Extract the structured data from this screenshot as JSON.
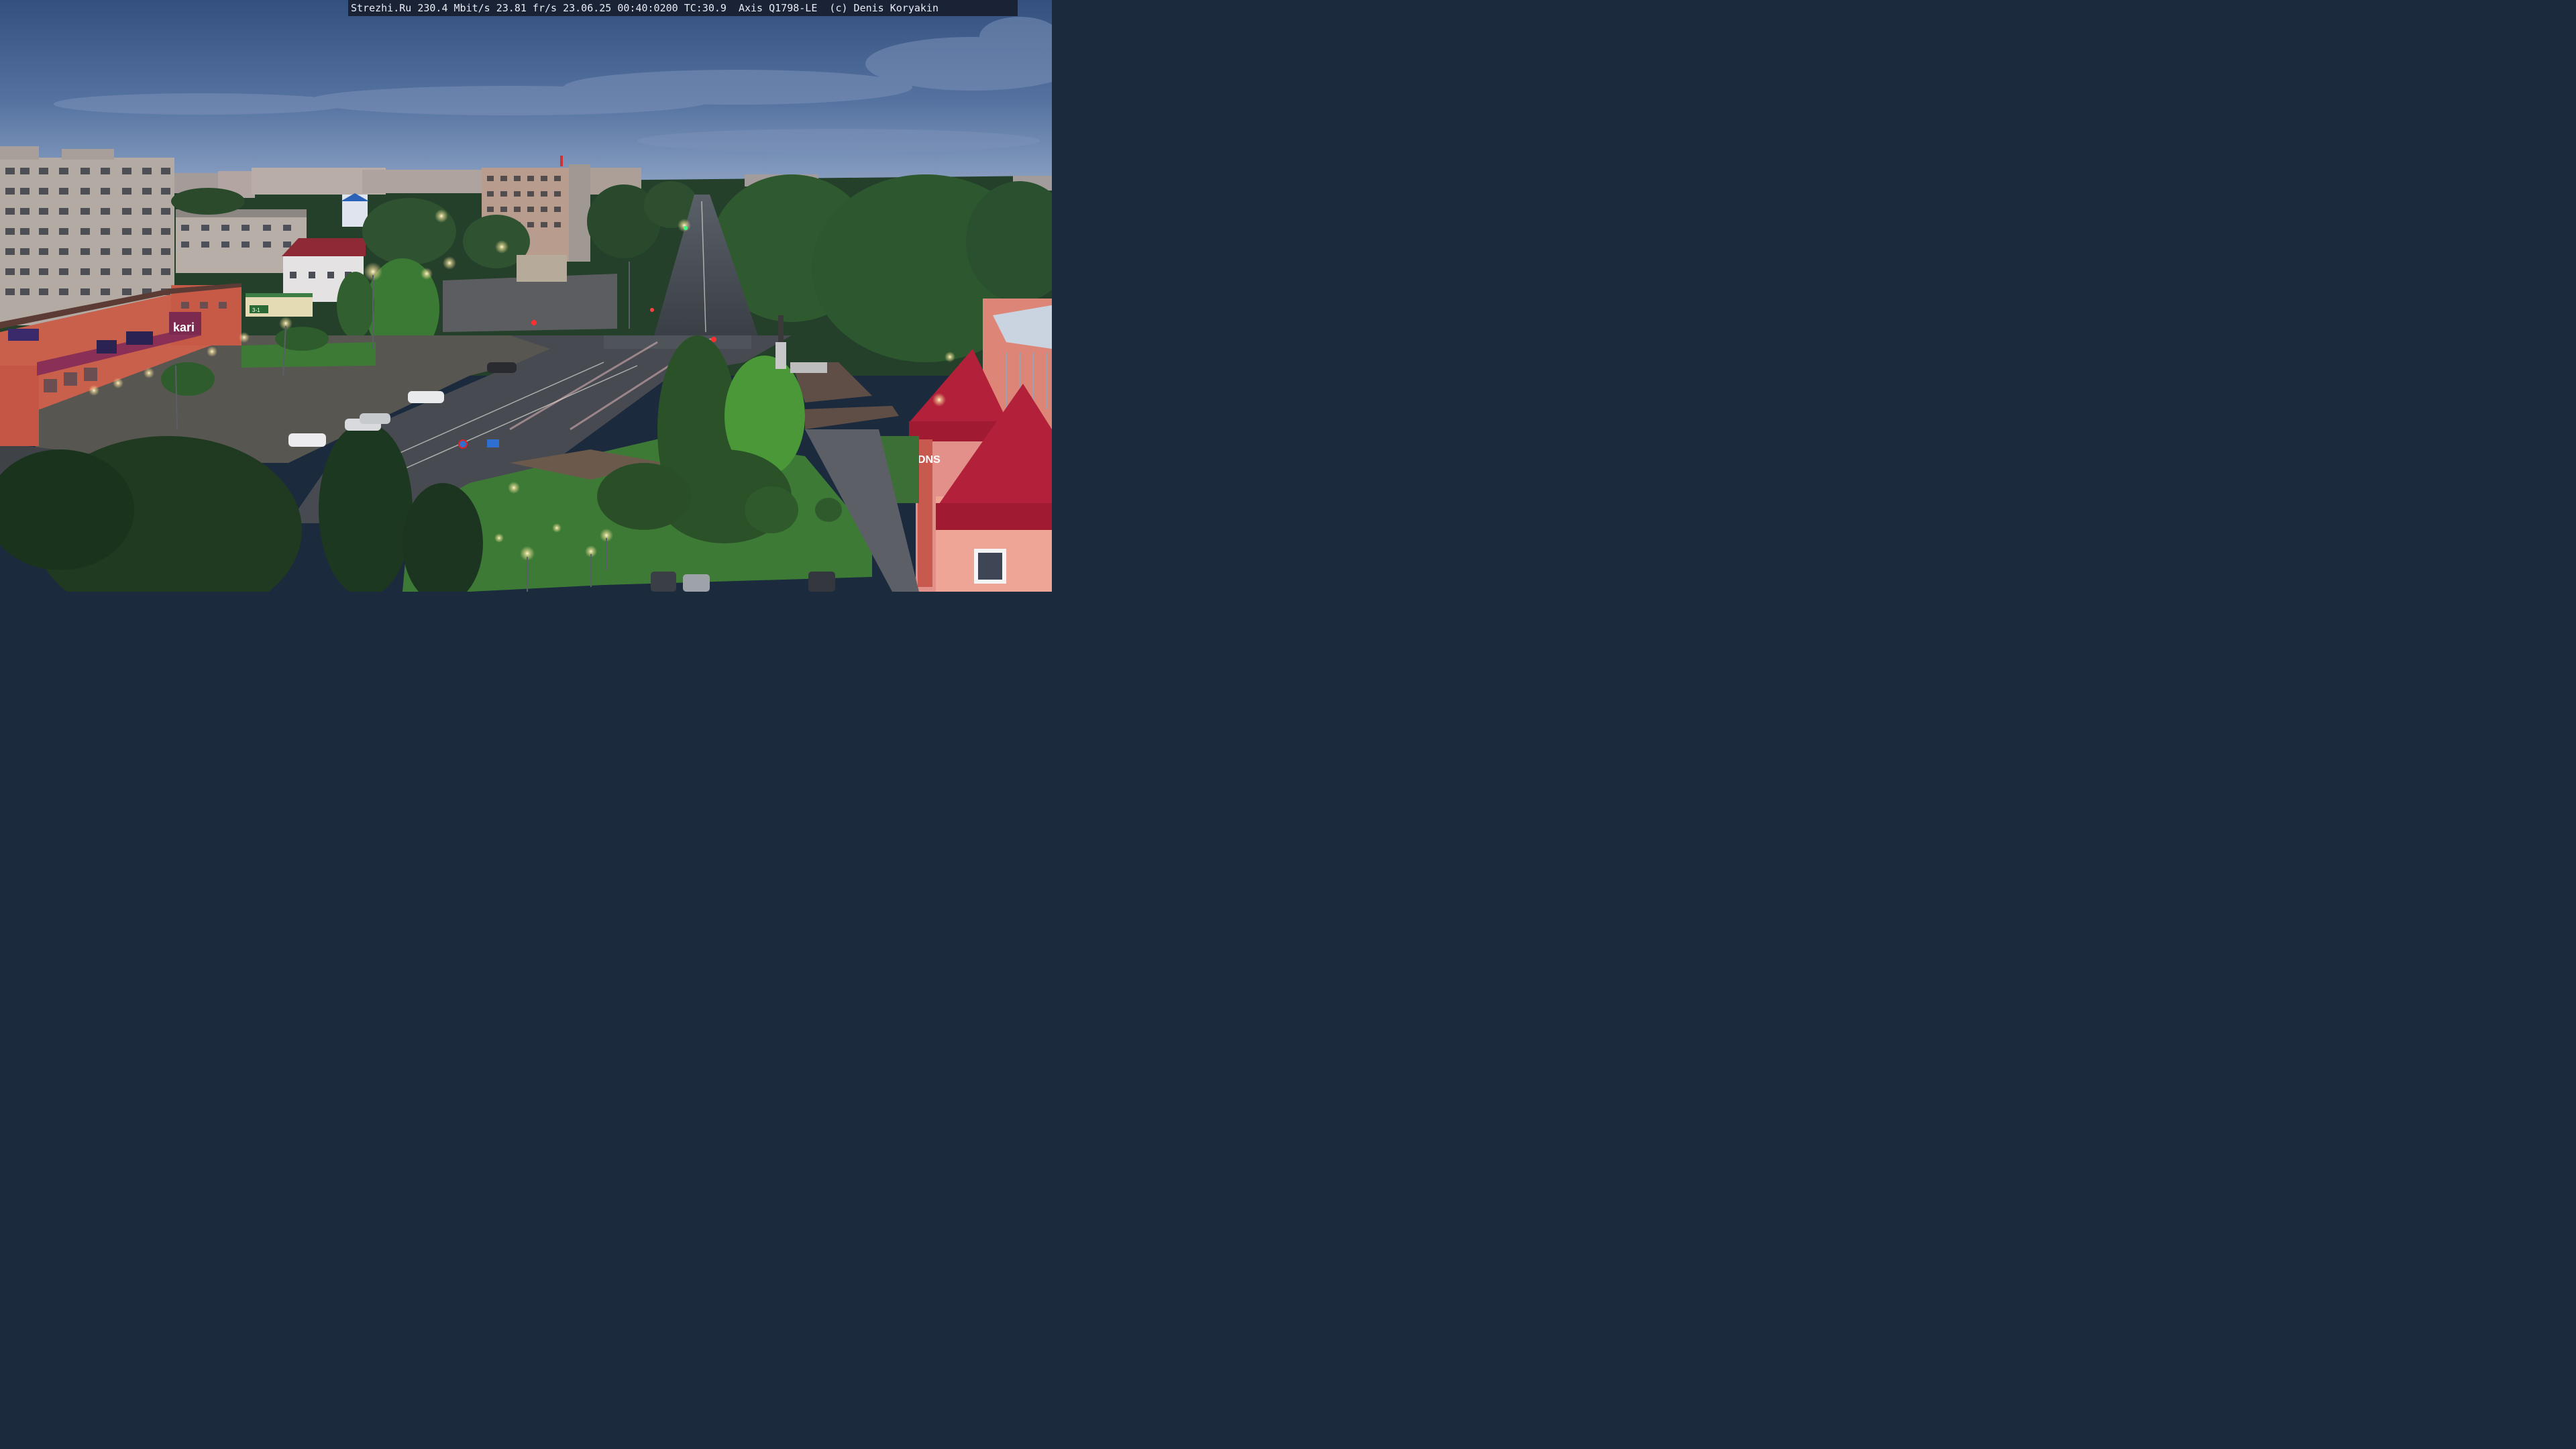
{
  "overlay": {
    "text": "Strezhi.Ru 230.4 Mbit/s 23.81 fr/s 23.06.25 00:40:0200 TC:30.9  Axis Q1798-LE  (c) Denis Koryakin"
  },
  "signs": {
    "kari": "kari",
    "dns": "DNS",
    "shop_number": "3-1"
  },
  "colors": {
    "sky_top": "#3b5684",
    "sky_horizon": "#7d96bd",
    "tree_dark": "#1c3520",
    "tree_mid": "#2f5a2d",
    "grass": "#3f7a35",
    "pavement": "#4a4d52",
    "road": "#3d4248",
    "apartment": "#b9ada6",
    "red_building": "#d0604a",
    "dns_building": "#e58d7e",
    "roof_red": "#b3203a",
    "lamp": "#fff4c8"
  }
}
